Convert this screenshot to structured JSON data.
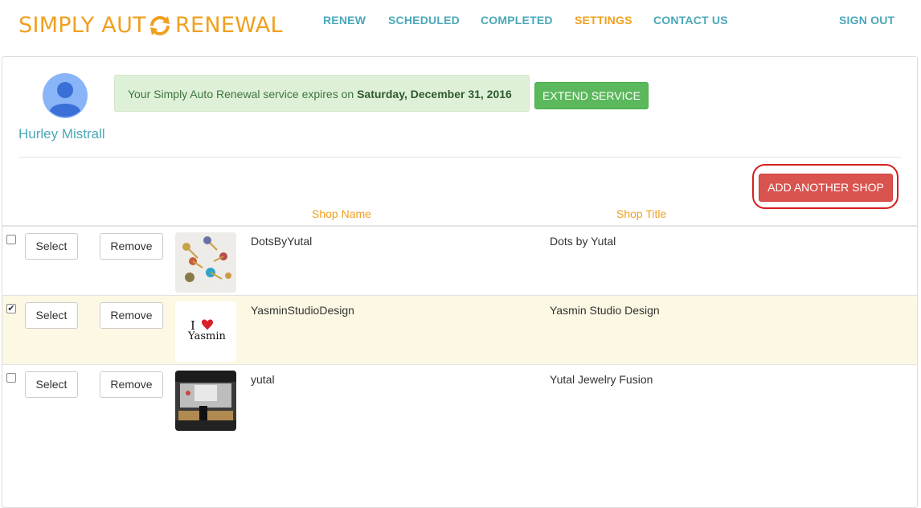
{
  "header": {
    "logo_left": "SIMPLY AUT",
    "logo_right": "RENEWAL",
    "nav": [
      {
        "label": "RENEW"
      },
      {
        "label": "SCHEDULED"
      },
      {
        "label": "COMPLETED"
      },
      {
        "label": "SETTINGS"
      },
      {
        "label": "CONTACT US"
      }
    ],
    "signout": "SIGN OUT",
    "active_nav": "SETTINGS"
  },
  "profile": {
    "name": "Hurley Mistrall"
  },
  "service": {
    "message_prefix": "Your Simply Auto Renewal service expires on",
    "expiry_date": "Saturday, December 31, 2016",
    "extend_label": "EXTEND SERVICE"
  },
  "shops": {
    "add_label": "ADD ANOTHER SHOP",
    "columns": {
      "name": "Shop Name",
      "title": "Shop Title"
    },
    "select_label": "Select",
    "remove_label": "Remove",
    "rows": [
      {
        "name": "DotsByYutal",
        "title": "Dots by Yutal",
        "checked": false
      },
      {
        "name": "YasminStudioDesign",
        "title": "Yasmin Studio Design",
        "checked": true,
        "logo_text": "Yasmin"
      },
      {
        "name": "yutal",
        "title": "Yutal Jewelry Fusion",
        "checked": false
      }
    ]
  },
  "colors": {
    "brand": "#f0a020",
    "nav": "#4aa8b8",
    "success": "#5cb85c",
    "danger": "#d9534f",
    "selected_row": "#fcf8e3"
  }
}
